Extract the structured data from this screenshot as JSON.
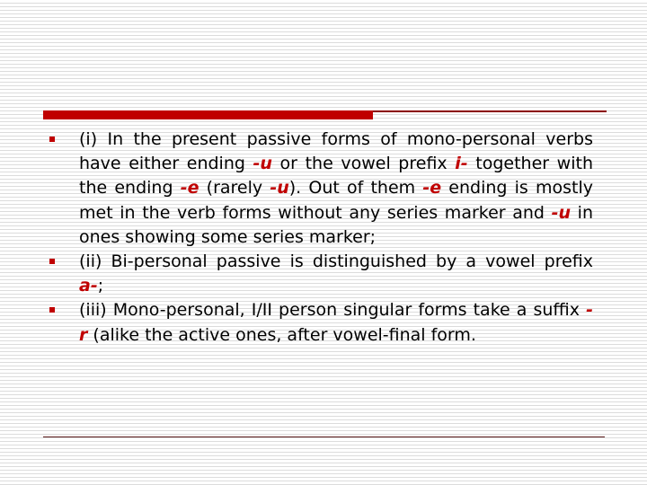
{
  "colors": {
    "accent": "#c00000",
    "text": "#000000",
    "stripe": "#dcdcdc"
  },
  "bullet_icon": "red-square-bullet",
  "items": [
    {
      "segments": [
        {
          "t": "(i) In the present passive forms of mono-personal verbs have either ending ",
          "hl": false
        },
        {
          "t": "-u",
          "hl": true
        },
        {
          "t": " or the vowel prefix ",
          "hl": false
        },
        {
          "t": "i-",
          "hl": true
        },
        {
          "t": " together with the ending ",
          "hl": false
        },
        {
          "t": "-e",
          "hl": true
        },
        {
          "t": " (rarely ",
          "hl": false
        },
        {
          "t": "-u",
          "hl": true
        },
        {
          "t": "). Out of them ",
          "hl": false
        },
        {
          "t": "-e",
          "hl": true
        },
        {
          "t": " ending is mostly met in the verb forms without any series marker and ",
          "hl": false
        },
        {
          "t": "-u",
          "hl": true
        },
        {
          "t": " in ones showing some series marker;",
          "hl": false
        }
      ]
    },
    {
      "segments": [
        {
          "t": "(ii) Bi-personal passive is distinguished by a vowel prefix ",
          "hl": false
        },
        {
          "t": "a-",
          "hl": true
        },
        {
          "t": ";",
          "hl": false
        }
      ]
    },
    {
      "segments": [
        {
          "t": "(iii) Mono-personal, I/II person singular forms take a suffix ",
          "hl": false
        },
        {
          "t": "-r",
          "hl": true
        },
        {
          "t": " (alike the active ones, after vowel-final form.",
          "hl": false
        }
      ]
    }
  ]
}
